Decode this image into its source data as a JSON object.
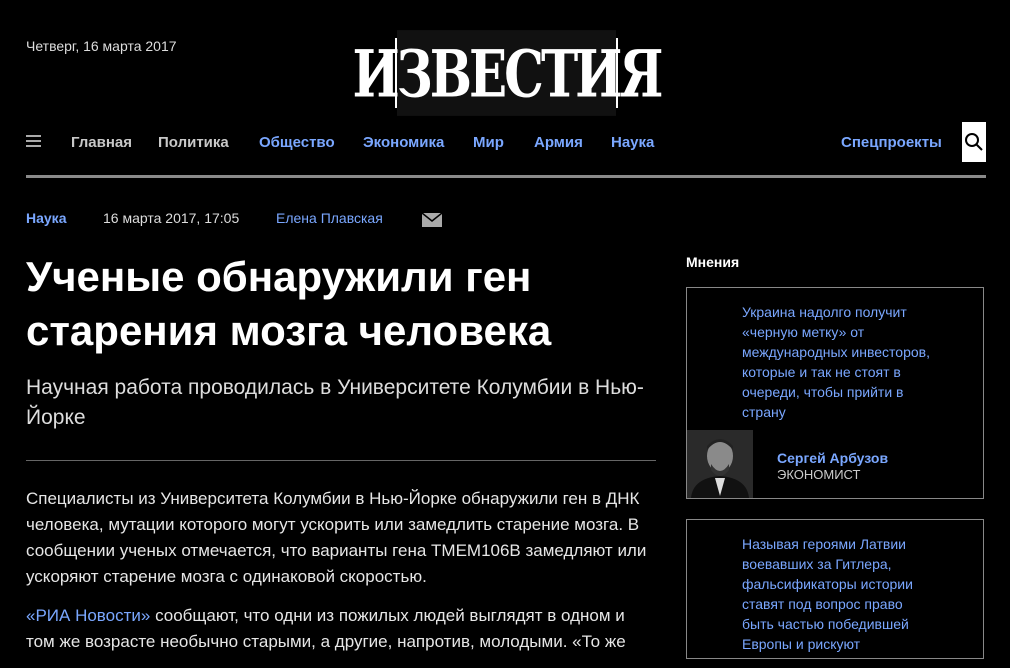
{
  "header": {
    "date": "Четверг, 16 марта 2017",
    "logo_text": "ИЗВЕСТИЯ"
  },
  "nav": {
    "items": [
      {
        "label": "Главная",
        "color": "#c8c8c8"
      },
      {
        "label": "Политика",
        "color": "#c8c8c8"
      },
      {
        "label": "Общество",
        "color": "#7aa7ff"
      },
      {
        "label": "Экономика",
        "color": "#7aa7ff"
      },
      {
        "label": "Мир",
        "color": "#7aa7ff"
      },
      {
        "label": "Армия",
        "color": "#7aa7ff"
      },
      {
        "label": "Наука",
        "color": "#7aa7ff"
      }
    ],
    "special": "Спецпроекты",
    "menu_icon": "hamburger-icon",
    "search_icon": "search-icon"
  },
  "article": {
    "category": "Наука",
    "datetime": "16 марта 2017, 17:05",
    "author": "Елена Плавская",
    "title": "Ученые обнаружили ген старения мозга человека",
    "subtitle": "Научная работа проводилась в Университете Колумбии в Нью-Йорке",
    "p1": "Специалисты из Университета Колумбии в Нью-Йорке обнаружили ген в ДНК человека, мутации которого могут ускорить или замедлить старение мозга. В сообщении ученых отмечается, что варианты гена TMEM106B замедляют или ускоряют старение мозга с одинаковой скоростью.",
    "p2_link": "«РИА Новости»",
    "p2_rest": " сообщают, что одни из пожилых людей выглядят в одном и том же возрасте необычно старыми, а другие, напротив, молодыми. «То же"
  },
  "sidebar": {
    "title": "Мнения",
    "cards": [
      {
        "text": "Украина надолго получит «черную метку» от международных инвесторов, которые и так не стоят в очереди, чтобы прийти в страну",
        "author": "Сергей Арбузов",
        "role": "экономист"
      },
      {
        "text": "Называя героями Латвии воевавших за Гитлера, фальсификаторы истории ставят под вопрос право быть частью победившей Европы и рискуют"
      }
    ]
  },
  "colors": {
    "accent": "#7aa7ff",
    "background": "#000000"
  }
}
